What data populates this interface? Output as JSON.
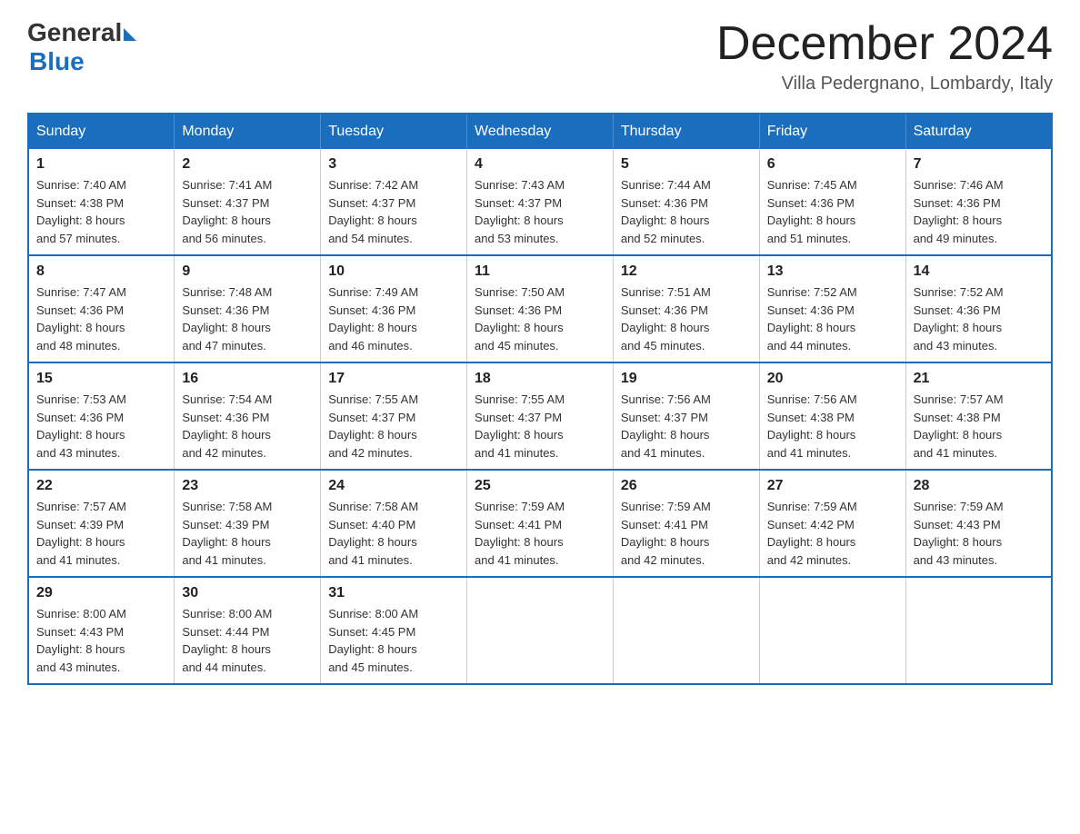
{
  "logo": {
    "general": "General",
    "blue": "Blue"
  },
  "title": "December 2024",
  "location": "Villa Pedergnano, Lombardy, Italy",
  "days_header": [
    "Sunday",
    "Monday",
    "Tuesday",
    "Wednesday",
    "Thursday",
    "Friday",
    "Saturday"
  ],
  "weeks": [
    [
      {
        "day": "1",
        "sunrise": "7:40 AM",
        "sunset": "4:38 PM",
        "daylight": "8 hours and 57 minutes."
      },
      {
        "day": "2",
        "sunrise": "7:41 AM",
        "sunset": "4:37 PM",
        "daylight": "8 hours and 56 minutes."
      },
      {
        "day": "3",
        "sunrise": "7:42 AM",
        "sunset": "4:37 PM",
        "daylight": "8 hours and 54 minutes."
      },
      {
        "day": "4",
        "sunrise": "7:43 AM",
        "sunset": "4:37 PM",
        "daylight": "8 hours and 53 minutes."
      },
      {
        "day": "5",
        "sunrise": "7:44 AM",
        "sunset": "4:36 PM",
        "daylight": "8 hours and 52 minutes."
      },
      {
        "day": "6",
        "sunrise": "7:45 AM",
        "sunset": "4:36 PM",
        "daylight": "8 hours and 51 minutes."
      },
      {
        "day": "7",
        "sunrise": "7:46 AM",
        "sunset": "4:36 PM",
        "daylight": "8 hours and 49 minutes."
      }
    ],
    [
      {
        "day": "8",
        "sunrise": "7:47 AM",
        "sunset": "4:36 PM",
        "daylight": "8 hours and 48 minutes."
      },
      {
        "day": "9",
        "sunrise": "7:48 AM",
        "sunset": "4:36 PM",
        "daylight": "8 hours and 47 minutes."
      },
      {
        "day": "10",
        "sunrise": "7:49 AM",
        "sunset": "4:36 PM",
        "daylight": "8 hours and 46 minutes."
      },
      {
        "day": "11",
        "sunrise": "7:50 AM",
        "sunset": "4:36 PM",
        "daylight": "8 hours and 45 minutes."
      },
      {
        "day": "12",
        "sunrise": "7:51 AM",
        "sunset": "4:36 PM",
        "daylight": "8 hours and 45 minutes."
      },
      {
        "day": "13",
        "sunrise": "7:52 AM",
        "sunset": "4:36 PM",
        "daylight": "8 hours and 44 minutes."
      },
      {
        "day": "14",
        "sunrise": "7:52 AM",
        "sunset": "4:36 PM",
        "daylight": "8 hours and 43 minutes."
      }
    ],
    [
      {
        "day": "15",
        "sunrise": "7:53 AM",
        "sunset": "4:36 PM",
        "daylight": "8 hours and 43 minutes."
      },
      {
        "day": "16",
        "sunrise": "7:54 AM",
        "sunset": "4:36 PM",
        "daylight": "8 hours and 42 minutes."
      },
      {
        "day": "17",
        "sunrise": "7:55 AM",
        "sunset": "4:37 PM",
        "daylight": "8 hours and 42 minutes."
      },
      {
        "day": "18",
        "sunrise": "7:55 AM",
        "sunset": "4:37 PM",
        "daylight": "8 hours and 41 minutes."
      },
      {
        "day": "19",
        "sunrise": "7:56 AM",
        "sunset": "4:37 PM",
        "daylight": "8 hours and 41 minutes."
      },
      {
        "day": "20",
        "sunrise": "7:56 AM",
        "sunset": "4:38 PM",
        "daylight": "8 hours and 41 minutes."
      },
      {
        "day": "21",
        "sunrise": "7:57 AM",
        "sunset": "4:38 PM",
        "daylight": "8 hours and 41 minutes."
      }
    ],
    [
      {
        "day": "22",
        "sunrise": "7:57 AM",
        "sunset": "4:39 PM",
        "daylight": "8 hours and 41 minutes."
      },
      {
        "day": "23",
        "sunrise": "7:58 AM",
        "sunset": "4:39 PM",
        "daylight": "8 hours and 41 minutes."
      },
      {
        "day": "24",
        "sunrise": "7:58 AM",
        "sunset": "4:40 PM",
        "daylight": "8 hours and 41 minutes."
      },
      {
        "day": "25",
        "sunrise": "7:59 AM",
        "sunset": "4:41 PM",
        "daylight": "8 hours and 41 minutes."
      },
      {
        "day": "26",
        "sunrise": "7:59 AM",
        "sunset": "4:41 PM",
        "daylight": "8 hours and 42 minutes."
      },
      {
        "day": "27",
        "sunrise": "7:59 AM",
        "sunset": "4:42 PM",
        "daylight": "8 hours and 42 minutes."
      },
      {
        "day": "28",
        "sunrise": "7:59 AM",
        "sunset": "4:43 PM",
        "daylight": "8 hours and 43 minutes."
      }
    ],
    [
      {
        "day": "29",
        "sunrise": "8:00 AM",
        "sunset": "4:43 PM",
        "daylight": "8 hours and 43 minutes."
      },
      {
        "day": "30",
        "sunrise": "8:00 AM",
        "sunset": "4:44 PM",
        "daylight": "8 hours and 44 minutes."
      },
      {
        "day": "31",
        "sunrise": "8:00 AM",
        "sunset": "4:45 PM",
        "daylight": "8 hours and 45 minutes."
      },
      null,
      null,
      null,
      null
    ]
  ],
  "labels": {
    "sunrise": "Sunrise:",
    "sunset": "Sunset:",
    "daylight": "Daylight:"
  }
}
